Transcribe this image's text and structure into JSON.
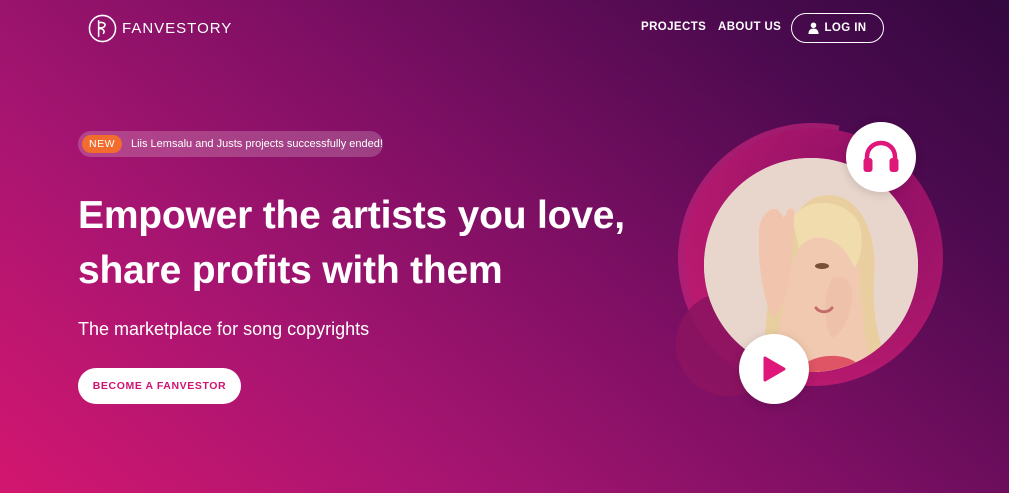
{
  "header": {
    "logo_text": "FANVESTORY",
    "nav": [
      {
        "label": "PROJECTS"
      },
      {
        "label": "ABOUT US"
      }
    ],
    "login_label": "LOG IN"
  },
  "hero": {
    "news_badge": "NEW",
    "news_text": "Liis Lemsalu and Justs projects successfully ended!",
    "headline_line1": "Empower the artists you love,",
    "headline_line2": "share profits with them",
    "subheadline": "The marketplace for song copyrights",
    "cta_label": "BECOME A FANVESTOR"
  },
  "icons": {
    "headphones": "headphones-icon",
    "play": "play-icon",
    "user": "user-icon",
    "logo": "fanvestory-logo-icon"
  },
  "colors": {
    "accent": "#e0177a",
    "badge": "#f26c2e",
    "cta_text": "#cf1372"
  }
}
